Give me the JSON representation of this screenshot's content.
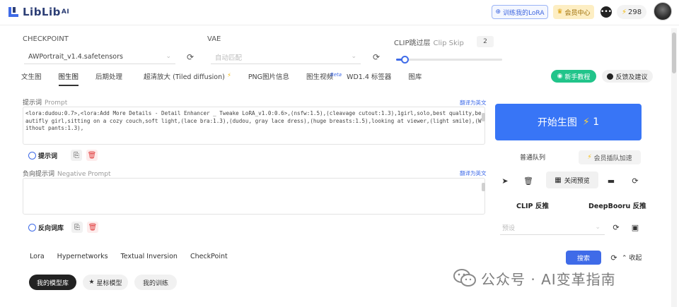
{
  "header": {
    "logo_text": "LibLib",
    "logo_sup": "AI",
    "train_lora_label": "训练我的LoRA",
    "member_center_label": "会员中心",
    "points": "298"
  },
  "settings": {
    "checkpoint_label": "CHECKPOINT",
    "checkpoint_value": "AWPortrait_v1.4.safetensors",
    "vae_label": "VAE",
    "vae_value": "自动匹配",
    "clip_label": "CLIP跳过层",
    "clip_sub": "Clip Skip",
    "clip_value": "2",
    "clip_slider_fraction": 0.08
  },
  "tabs": [
    {
      "label": "文生图"
    },
    {
      "label": "图生图"
    },
    {
      "label": "后期处理"
    },
    {
      "label": "超清放大 (Tiled diffusion)"
    },
    {
      "label": "PNG图片信息"
    },
    {
      "label": "图生视频",
      "badge": "Beta"
    },
    {
      "label": "WD1.4 标签器"
    },
    {
      "label": "图库"
    }
  ],
  "side_actions": {
    "tutorial_label": "新手教程",
    "feedback_label": "反馈及建议"
  },
  "prompt": {
    "label": "提示词",
    "sub": "Prompt",
    "translate": "翻译为英文",
    "text": "<lora:dudou:0.7>,<lora:Add More Details - Detail Enhancer _ Tweake LoRA_v1.0:0.6>,(nsfw:1.5),(cleavage cutout:1.3),1girl,solo,best quality,beautifly girl,sitting on a cozy couch,soft light,(lace bra:1.3),(dudou, gray lace dress),(huge breasts:1.5),looking at viewer,(light smile),(Without pants:1.3),",
    "tool_label": "提示词"
  },
  "negative": {
    "label": "负向提示词",
    "sub": "Negative Prompt",
    "translate": "翻译为英文",
    "tool_label": "反向词库"
  },
  "generate": {
    "label": "开始生图",
    "cost": "1"
  },
  "queue": {
    "normal_label": "普通队列",
    "vip_label": "会员插队加速"
  },
  "preview": {
    "close_label": "关闭预览"
  },
  "reverse": {
    "clip_label": "CLIP 反推",
    "deepbooru_label": "DeepBooru 反推",
    "select_placeholder": "预设"
  },
  "models": {
    "tabs": [
      "Lora",
      "Hypernetworks",
      "Textual Inversion",
      "CheckPoint"
    ],
    "search_label": "搜索",
    "collapse_label": "收起",
    "my_models_label": "我的模型库",
    "starred_label": "星标模型",
    "my_training_label": "我的训练"
  },
  "watermark": {
    "text": "公众号 · AI变革指南"
  }
}
